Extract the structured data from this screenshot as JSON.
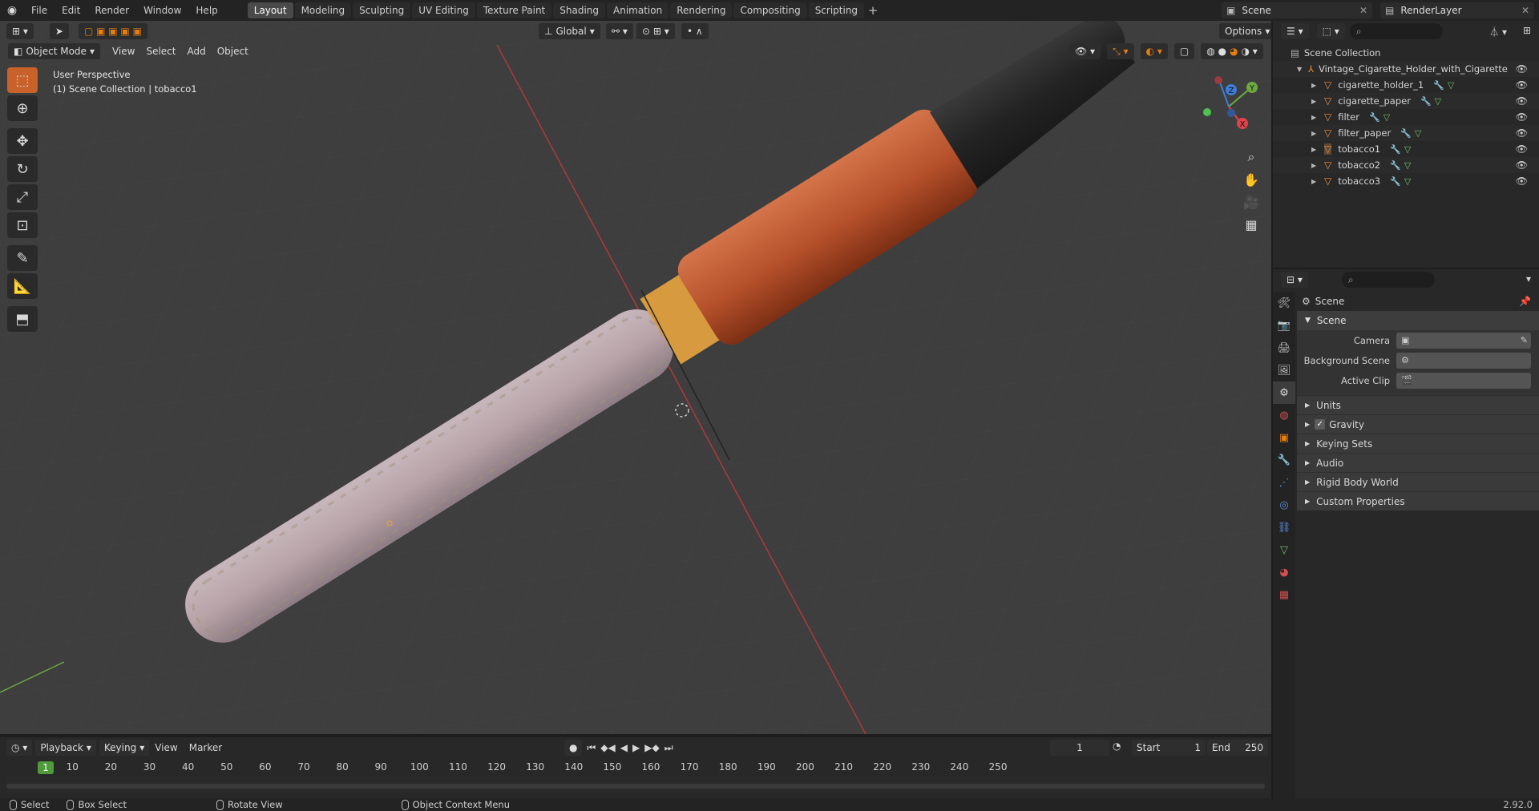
{
  "topbar": {
    "menus": [
      "File",
      "Edit",
      "Render",
      "Window",
      "Help"
    ],
    "workspaces": [
      "Layout",
      "Modeling",
      "Sculpting",
      "UV Editing",
      "Texture Paint",
      "Shading",
      "Animation",
      "Rendering",
      "Compositing",
      "Scripting"
    ],
    "active_workspace": "Layout",
    "add_tab": "+",
    "scene_name": "Scene",
    "view_layer": "RenderLayer"
  },
  "viewport": {
    "mode": "Object Mode",
    "menus": [
      "View",
      "Select",
      "Add",
      "Object"
    ],
    "orientation": "Global",
    "options_label": "Options",
    "info_line1": "User Perspective",
    "info_line2": "(1) Scene Collection | tobacco1",
    "gizmo": {
      "x": "X",
      "y": "Y",
      "z": "Z"
    }
  },
  "timeline": {
    "playback": "Playback",
    "keying": "Keying",
    "menus": [
      "View",
      "Marker"
    ],
    "current_frame": "1",
    "start_label": "Start",
    "start_value": "1",
    "end_label": "End",
    "end_value": "250",
    "ticks": [
      "1",
      "10",
      "20",
      "30",
      "40",
      "50",
      "60",
      "70",
      "80",
      "90",
      "100",
      "110",
      "120",
      "130",
      "140",
      "150",
      "160",
      "170",
      "180",
      "190",
      "200",
      "210",
      "220",
      "230",
      "240",
      "250"
    ]
  },
  "statusbar": {
    "select": "Select",
    "box_select": "Box Select",
    "rotate_view": "Rotate View",
    "context_menu": "Object Context Menu",
    "version": "2.92.0"
  },
  "outliner": {
    "root": "Scene Collection",
    "collection": "Vintage_Cigarette_Holder_with_Cigarette",
    "objects": [
      "cigarette_holder_1",
      "cigarette_paper",
      "filter",
      "filter_paper",
      "tobacco1",
      "tobacco2",
      "tobacco3"
    ]
  },
  "properties": {
    "context": "Scene",
    "panel": "Scene",
    "rows": [
      {
        "label": "Camera"
      },
      {
        "label": "Background Scene"
      },
      {
        "label": "Active Clip"
      }
    ],
    "subpanels": [
      "Units",
      "Gravity",
      "Keying Sets",
      "Audio",
      "Rigid Body World",
      "Custom Properties"
    ]
  },
  "colors": {
    "accent": "#e87d0d",
    "active_tool": "#56687d",
    "axis_x": "#e1434b",
    "axis_y": "#6da93e",
    "axis_z": "#3d7dd9",
    "playhead": "#4f9b3b"
  }
}
